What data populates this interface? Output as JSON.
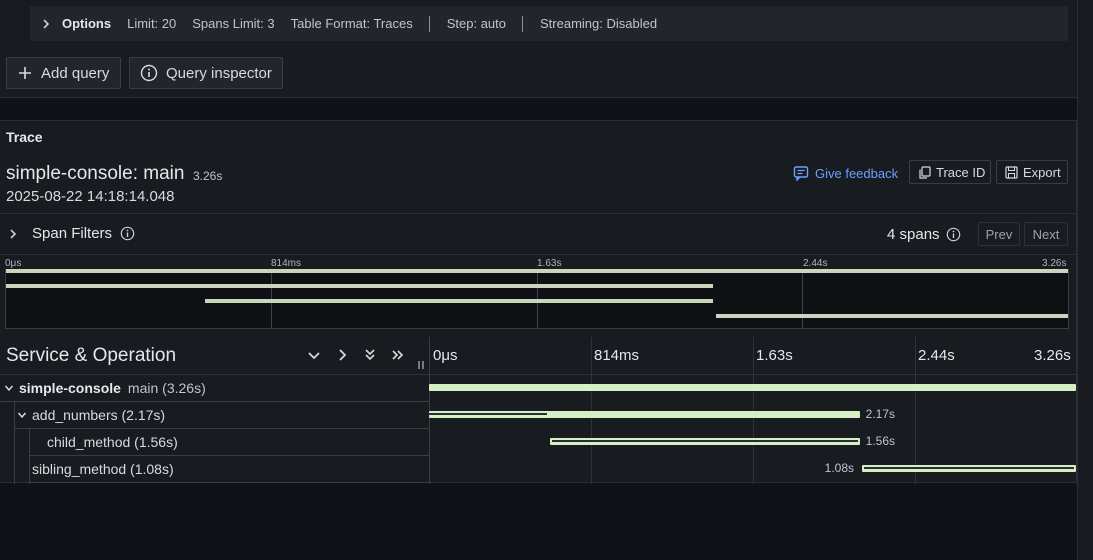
{
  "options": {
    "title": "Options",
    "items": [
      "Limit: 20",
      "Spans Limit: 3",
      "Table Format: Traces"
    ],
    "step": "Step: auto",
    "streaming": "Streaming: Disabled"
  },
  "toolbar": {
    "add_query": "Add query",
    "query_inspector": "Query inspector"
  },
  "panel": {
    "title": "Trace",
    "trace_name": "simple-console: main",
    "trace_duration": "3.26s",
    "trace_start": "2025-08-22 14:18:14.048",
    "give_feedback": "Give feedback",
    "trace_id_btn": "Trace ID",
    "export_btn": "Export",
    "span_filters": "Span Filters",
    "spans_count": "4 spans",
    "prev": "Prev",
    "next": "Next"
  },
  "minimap": {
    "ticks": [
      "0μs",
      "814ms",
      "1.63s",
      "2.44s",
      "3.26s"
    ]
  },
  "timeline": {
    "header": "Service & Operation",
    "ticks": [
      "0μs",
      "814ms",
      "1.63s",
      "2.44s",
      "3.26s"
    ],
    "total_seconds": 3.26
  },
  "spans": [
    {
      "service": "simple-console",
      "operation": "main (3.26s)",
      "start": 0.0,
      "duration": 3.26,
      "duration_label": ""
    },
    {
      "service": "",
      "operation": "add_numbers (2.17s)",
      "start": 0.0,
      "duration": 2.17,
      "duration_label": "2.17s"
    },
    {
      "service": "",
      "operation": "child_method (1.56s)",
      "start": 0.61,
      "duration": 1.56,
      "duration_label": "1.56s"
    },
    {
      "service": "",
      "operation": "sibling_method (1.08s)",
      "start": 2.18,
      "duration": 1.08,
      "duration_label": "1.08s"
    }
  ],
  "colors": {
    "span_bar": "#d5f0c4",
    "link": "#6e9fff",
    "background": "#111217",
    "panel": "#181b1f"
  }
}
